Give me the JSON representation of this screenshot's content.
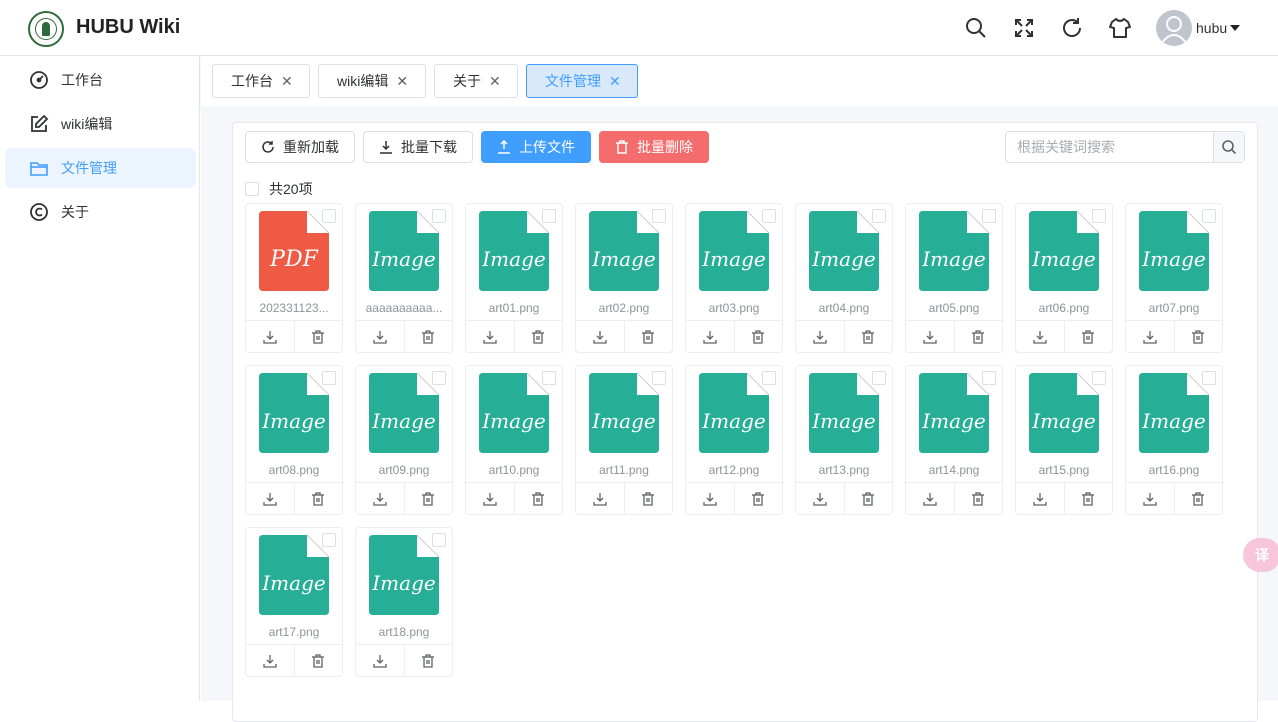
{
  "header": {
    "brand": "HUBU Wiki",
    "user_name": "hubu",
    "icons": [
      "search-icon",
      "fullscreen-icon",
      "refresh-icon",
      "theme-icon"
    ]
  },
  "sidebar": {
    "items": [
      {
        "label": "工作台",
        "icon": "dashboard-icon",
        "active": false
      },
      {
        "label": "wiki编辑",
        "icon": "edit-icon",
        "active": false
      },
      {
        "label": "文件管理",
        "icon": "folder-icon",
        "active": true
      },
      {
        "label": "关于",
        "icon": "copyright-icon",
        "active": false
      }
    ]
  },
  "tabs": [
    {
      "label": "工作台",
      "active": false
    },
    {
      "label": "wiki编辑",
      "active": false
    },
    {
      "label": "关于",
      "active": false
    },
    {
      "label": "文件管理",
      "active": true
    }
  ],
  "toolbar": {
    "reload_label": "重新加载",
    "batch_download_label": "批量下载",
    "upload_label": "上传文件",
    "batch_delete_label": "批量删除",
    "search_placeholder": "根据关键词搜索"
  },
  "select_all_label": "共20项",
  "files": [
    {
      "name": "202331123...",
      "type": "PDF"
    },
    {
      "name": "aaaaaaaaaa...",
      "type": "Image"
    },
    {
      "name": "art01.png",
      "type": "Image"
    },
    {
      "name": "art02.png",
      "type": "Image"
    },
    {
      "name": "art03.png",
      "type": "Image"
    },
    {
      "name": "art04.png",
      "type": "Image"
    },
    {
      "name": "art05.png",
      "type": "Image"
    },
    {
      "name": "art06.png",
      "type": "Image"
    },
    {
      "name": "art07.png",
      "type": "Image"
    },
    {
      "name": "art08.png",
      "type": "Image"
    },
    {
      "name": "art09.png",
      "type": "Image"
    },
    {
      "name": "art10.png",
      "type": "Image"
    },
    {
      "name": "art11.png",
      "type": "Image"
    },
    {
      "name": "art12.png",
      "type": "Image"
    },
    {
      "name": "art13.png",
      "type": "Image"
    },
    {
      "name": "art14.png",
      "type": "Image"
    },
    {
      "name": "art15.png",
      "type": "Image"
    },
    {
      "name": "art16.png",
      "type": "Image"
    },
    {
      "name": "art17.png",
      "type": "Image"
    },
    {
      "name": "art18.png",
      "type": "Image"
    }
  ],
  "colors": {
    "primary": "#409eff",
    "danger": "#f56c6c",
    "image_file": "#26ae96",
    "pdf_file": "#ee5a44"
  }
}
